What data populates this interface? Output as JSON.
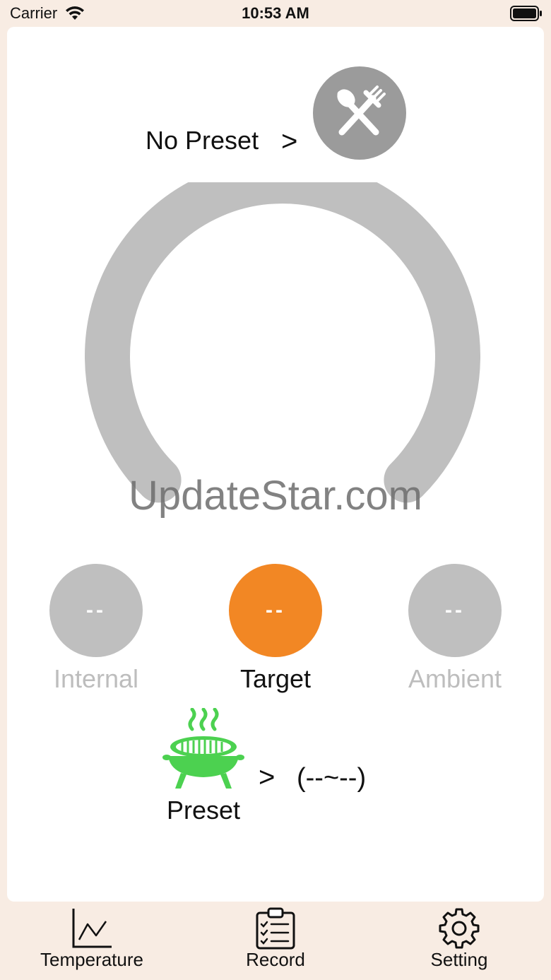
{
  "status_bar": {
    "carrier": "Carrier",
    "time": "10:53 AM"
  },
  "preset_header": {
    "label": "No Preset",
    "chevron": ">",
    "icon": "fork-spoon-icon"
  },
  "gauge": {
    "color": "#bfbfbf"
  },
  "watermark": "UpdateStar.com",
  "readings": [
    {
      "value": "--",
      "label": "Internal",
      "color": "#bfbfbf"
    },
    {
      "value": "--",
      "label": "Target",
      "color": "#f28724"
    },
    {
      "value": "--",
      "label": "Ambient",
      "color": "#bfbfbf"
    }
  ],
  "preset_footer": {
    "label": "Preset",
    "chevron": ">",
    "range": "(--~--)",
    "icon": "grill-icon",
    "icon_color": "#4cd150"
  },
  "tabs": [
    {
      "label": "Temperature",
      "icon": "line-chart-icon"
    },
    {
      "label": "Record",
      "icon": "clipboard-icon"
    },
    {
      "label": "Setting",
      "icon": "gear-icon"
    }
  ]
}
